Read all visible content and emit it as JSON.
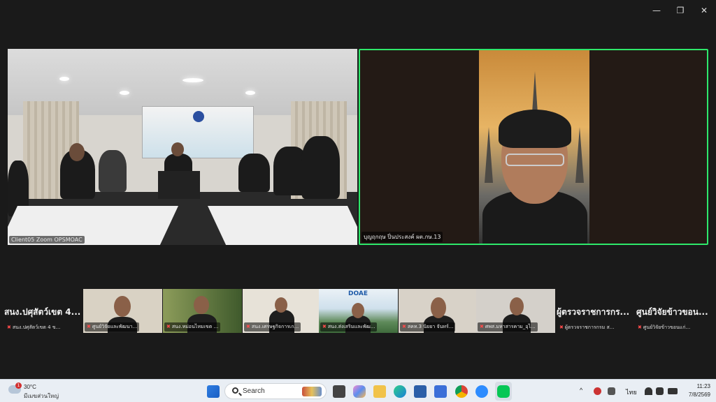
{
  "window_controls": {
    "minimize": "—",
    "restore": "❐",
    "close": "✕"
  },
  "main_video": {
    "name": "Client05 Zoom OPSMOAC"
  },
  "speaker_video": {
    "name": "บุญฤกฤษ ปิ่นประสงค์ ผต.กษ.13"
  },
  "strip": {
    "left_label": "สนง.ปศุสัตว์เขต 4...",
    "left_sub": "สนง.ปศุสัตว์เขต 4 ข...",
    "right1_label": "ผู้ตรวจราชการกร...",
    "right1_sub": "ผู้ตรวจราชการกรม ส...",
    "right2_label": "ศูนย์วิจัยข้าวขอน...",
    "right2_sub": "ศูนย์วิจัยข้าวขอนแก่...",
    "thumbs": [
      {
        "name": "ศูนย์วิจัยและพัฒนา..."
      },
      {
        "name": "สนง.หม่อนไหมเขต ..."
      },
      {
        "name": "สนง.เศรษฐกิจการเก..."
      },
      {
        "name": "สนง.ส่งเสริมและพัฒ..."
      },
      {
        "name": "สคท.3 นิยยา จันทร์..."
      },
      {
        "name": "ศพส.มหาสารคาม_อุไ..."
      }
    ],
    "thumb4_logo": "DOAE"
  },
  "taskbar": {
    "weather_badge": "1",
    "weather_temp": "30°C",
    "weather_desc": "มีเมฆส่วนใหญ่",
    "search_placeholder": "Search",
    "tray_chevron": "^",
    "language": "ไทย",
    "time": "11:23",
    "date": "7/8/2569"
  },
  "colors": {
    "active_speaker_border": "#2ee86b",
    "mic_off": "#ff4b4b",
    "taskbar_bg": "#e9eef4"
  }
}
